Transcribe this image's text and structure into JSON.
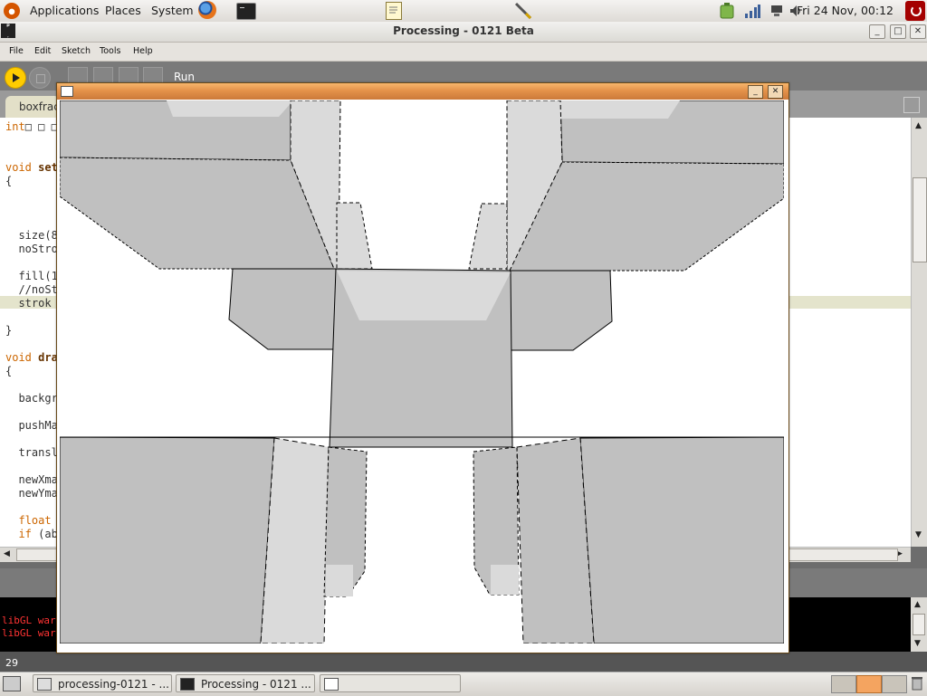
{
  "top_panel": {
    "menus": [
      "Applications",
      "Places",
      "System"
    ],
    "clock": "Fri 24 Nov, 00:12"
  },
  "main_window": {
    "title": "Processing - 0121 Beta",
    "menu": [
      "File",
      "Edit",
      "Sketch",
      "Tools",
      "Help"
    ],
    "toolbar_status": "Run",
    "tab": "boxfrac",
    "code_lines": [
      {
        "pre": "",
        "kw": "int",
        "post": "□ □ □"
      },
      {
        "pre": "",
        "kw": "void",
        "bold": "set",
        "post": ""
      },
      {
        "pre": "{",
        "kw": "",
        "post": ""
      },
      {
        "pre": "  size(8",
        "kw": "",
        "post": ""
      },
      {
        "pre": "  noStro",
        "kw": "",
        "post": ""
      },
      {
        "pre": "  fill(1",
        "kw": "",
        "post": ""
      },
      {
        "pre": "  //noSt",
        "kw": "",
        "post": ""
      },
      {
        "pre": "  strok",
        "kw": "",
        "post": ""
      },
      {
        "pre": "}",
        "kw": "",
        "post": ""
      },
      {
        "pre": "",
        "kw": "void",
        "bold": "dra",
        "post": ""
      },
      {
        "pre": "{",
        "kw": "",
        "post": ""
      },
      {
        "pre": "  backgr",
        "kw": "",
        "post": ""
      },
      {
        "pre": "  pushMa",
        "kw": "",
        "post": ""
      },
      {
        "pre": "  transl",
        "kw": "",
        "post": ""
      },
      {
        "pre": "  newXma",
        "kw": "",
        "post": ""
      },
      {
        "pre": "  newYma",
        "kw": "",
        "post": ""
      },
      {
        "pre": "  ",
        "kw": "float",
        "post": ""
      },
      {
        "pre": "  ",
        "kw": "if",
        "post": " (ab"
      }
    ],
    "console_lines": [
      "libGL war",
      "libGL war"
    ],
    "line_number": "29"
  },
  "taskbar": {
    "tasks": [
      "processing-0121 - ...",
      "Processing - 0121 ..."
    ]
  }
}
